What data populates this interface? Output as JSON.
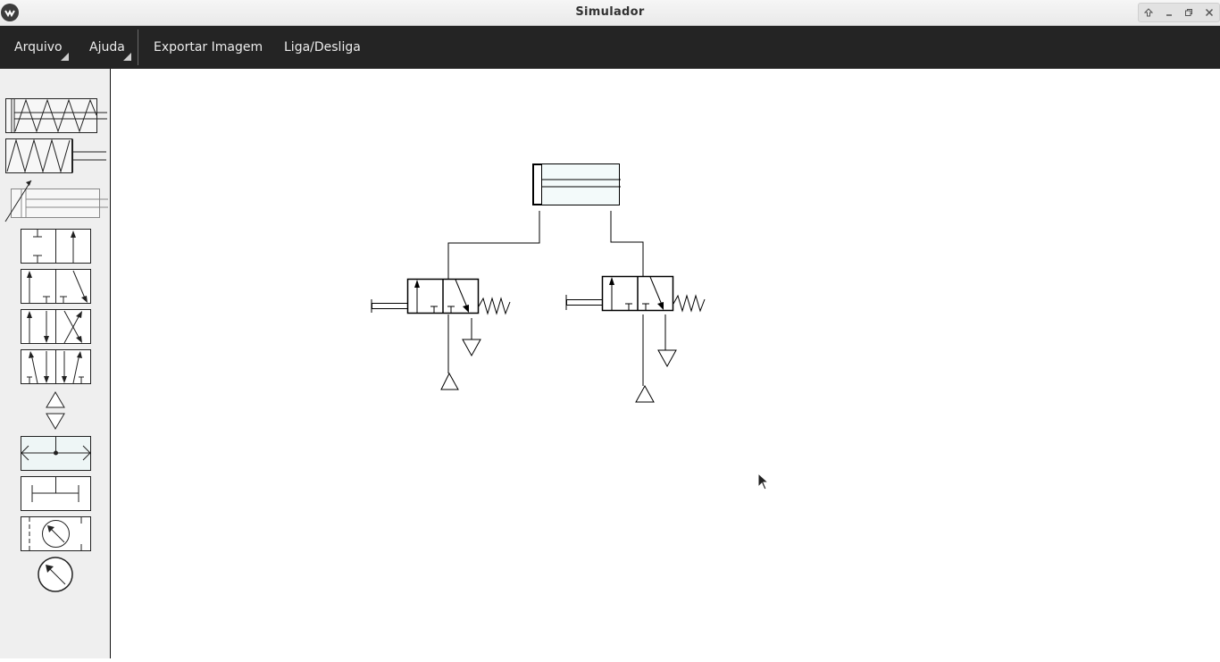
{
  "window": {
    "title": "Simulador"
  },
  "menu": {
    "arquivo": "Arquivo",
    "ajuda": "Ajuda",
    "exportar": "Exportar Imagem",
    "liga": "Liga/Desliga"
  },
  "icons": {
    "app": "app-logo-icon",
    "window_controls": [
      "keep-above-icon",
      "minimize-icon",
      "maximize-icon",
      "close-icon"
    ]
  },
  "palette": [
    "single-acting-cylinder-spring",
    "single-acting-cylinder-spring-rod",
    "adjustable-cylinder",
    "valve-2-2",
    "valve-3-2",
    "valve-4-2",
    "valve-5-2",
    "pressure-source",
    "exhaust",
    "flow-connector",
    "pipe-junction",
    "pressure-gauge-block",
    "pressure-gauge"
  ],
  "colors": {
    "menubar": "#242424",
    "sidebar": "#efefef",
    "canvas": "#ffffff",
    "line": "#000000"
  }
}
